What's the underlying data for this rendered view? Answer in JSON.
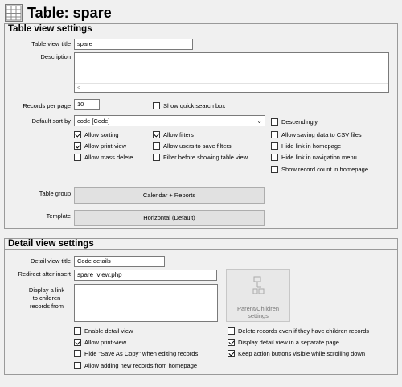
{
  "page": {
    "title": "Table: spare",
    "icon": "table-grid-icon"
  },
  "table_view": {
    "header": "Table view settings",
    "title_label": "Table view title",
    "title_value": "spare",
    "description_label": "Description",
    "description_value": "",
    "records_label": "Records per page",
    "records_value": "10",
    "quick_search": {
      "label": "Show quick search box",
      "checked": false
    },
    "sort_label": "Default sort by",
    "sort_value": "code [Code]",
    "descending": {
      "label": "Descendingly",
      "checked": false
    },
    "options": [
      {
        "label": "Allow sorting",
        "checked": true
      },
      {
        "label": "Allow filters",
        "checked": true
      },
      {
        "label": "Allow saving data to CSV files",
        "checked": false
      },
      {
        "label": "Allow print-view",
        "checked": true
      },
      {
        "label": "Allow users to save filters",
        "checked": false
      },
      {
        "label": "Hide link in homepage",
        "checked": false
      },
      {
        "label": "Allow mass delete",
        "checked": false
      },
      {
        "label": "Filter before showing table view",
        "checked": false
      },
      {
        "label": "Hide link in navigation menu",
        "checked": false
      },
      {
        "label": "Show record count in homepage",
        "checked": false
      }
    ],
    "group_label": "Table group",
    "group_value": "Calendar + Reports",
    "template_label": "Template",
    "template_value": "Horizontal (Default)"
  },
  "detail_view": {
    "header": "Detail view settings",
    "title_label": "Detail view title",
    "title_value": "Code details",
    "redirect_label": "Redirect after insert",
    "redirect_value": "spare_view.php",
    "children_label_1": "Display a link",
    "children_label_2": "to children",
    "children_label_3": "records from",
    "parent_children_btn_1": "Parent/Children",
    "parent_children_btn_2": "settings",
    "options": [
      {
        "label": "Enable detail view",
        "checked": false
      },
      {
        "label": "Delete records even if they have children records",
        "checked": false
      },
      {
        "label": "Allow print-view",
        "checked": true
      },
      {
        "label": "Display detail view in a separate page",
        "checked": true
      },
      {
        "label": "Hide \"Save As Copy\" when editing records",
        "checked": false
      },
      {
        "label": "Keep action buttons visible while scrolling down",
        "checked": true
      },
      {
        "label": "Allow adding new records from homepage",
        "checked": false
      }
    ]
  }
}
